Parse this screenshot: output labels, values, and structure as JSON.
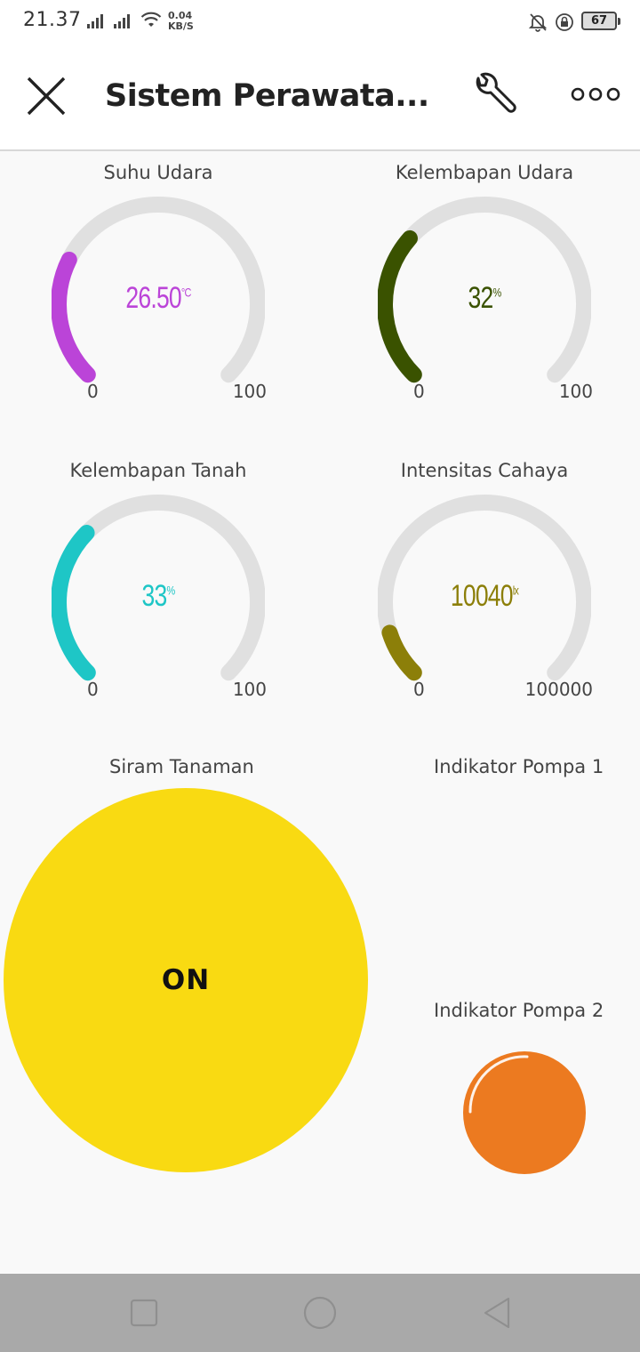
{
  "status_bar": {
    "time": "21.37",
    "net_speed_value": "0.04",
    "net_speed_unit": "KB/S",
    "battery": "67"
  },
  "app_bar": {
    "title": "Sistem Perawata..."
  },
  "gauges": [
    {
      "title": "Suhu Udara",
      "value": "26.50",
      "unit": "°C",
      "min": "0",
      "max": "100",
      "fraction": 0.265,
      "color": "#bb44d8"
    },
    {
      "title": "Kelembapan Udara",
      "value": "32",
      "unit": "%",
      "min": "0",
      "max": "100",
      "fraction": 0.32,
      "color": "#3a5200"
    },
    {
      "title": "Kelembapan Tanah",
      "value": "33",
      "unit": "%",
      "min": "0",
      "max": "100",
      "fraction": 0.33,
      "color": "#1ec6c6"
    },
    {
      "title": "Intensitas Cahaya",
      "value": "10040",
      "unit": "lx",
      "min": "0",
      "max": "100000",
      "fraction": 0.1004,
      "color": "#8c7f09"
    }
  ],
  "button": {
    "title": "Siram Tanaman",
    "state_label": "ON",
    "color": "#f9da12"
  },
  "indicators": [
    {
      "title": "Indikator Pompa 1",
      "visible": false
    },
    {
      "title": "Indikator Pompa 2",
      "color": "#ec7a20"
    }
  ],
  "colors": {
    "gauge_track": "#e0e0e0",
    "background": "#f9f9f9"
  }
}
